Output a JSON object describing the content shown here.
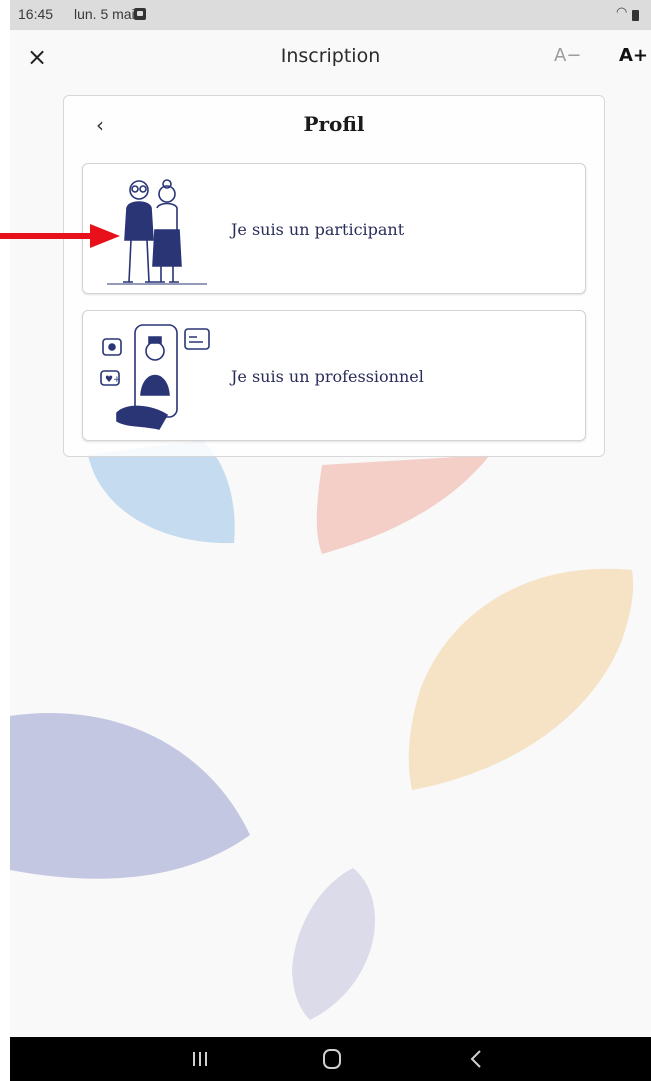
{
  "status_bar": {
    "time": "16:45",
    "date": "lun. 5 mai",
    "notification_icon": "image-icon",
    "wifi_icon": "wifi-icon",
    "battery_icon": "battery-icon"
  },
  "app_bar": {
    "title": "Inscription",
    "close_label": "×",
    "font_decrease_label": "A−",
    "font_increase_label": "A+"
  },
  "card": {
    "title": "Profil",
    "back_label": "‹",
    "options": [
      {
        "label": "Je suis un participant",
        "illustration": "elderly-couple-illustration"
      },
      {
        "label": "Je suis un professionnel",
        "illustration": "health-professional-illustration"
      }
    ]
  },
  "annotation": {
    "arrow_color": "#e8101a"
  },
  "colors": {
    "text_dark": "#2a2d5a",
    "background": "#f9f9f9",
    "petal_blue": "#c5dbef",
    "petal_pink": "#f3cfc8",
    "petal_orange": "#f6e3c6",
    "petal_indigo": "#c3c7e2",
    "petal_lavender": "#dcdbe9"
  },
  "nav_bar": {
    "recent_icon": "recent-apps-icon",
    "home_icon": "home-icon",
    "back_icon": "back-icon"
  }
}
